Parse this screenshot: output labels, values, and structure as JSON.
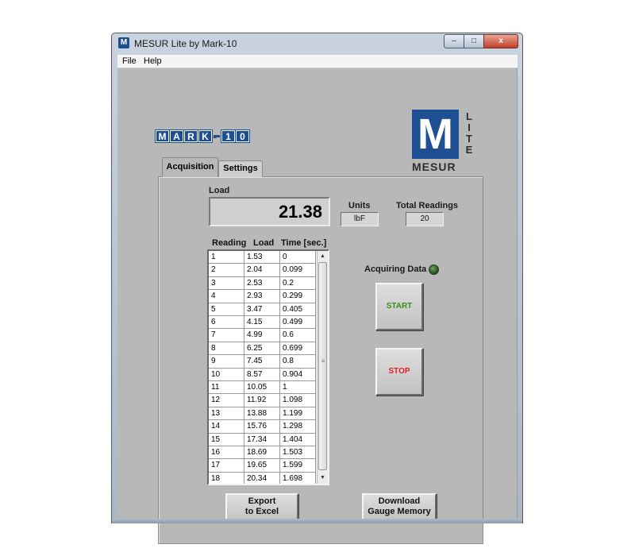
{
  "window": {
    "title": "MESUR Lite by Mark-10",
    "min_glyph": "–",
    "max_glyph": "□",
    "close_glyph": "x"
  },
  "menu": {
    "file": "File",
    "help": "Help"
  },
  "branding": {
    "mark10_letters": [
      "M",
      "A",
      "R",
      "K",
      "-",
      "1",
      "0"
    ],
    "mesur_m": "M",
    "mesur_word": "MESUR",
    "lite_letters": [
      "L",
      "I",
      "T",
      "E"
    ],
    "brand_color": "#1f4f93"
  },
  "tabs": {
    "acquisition": "Acquisition",
    "settings": "Settings",
    "active": "Acquisition"
  },
  "load": {
    "label": "Load",
    "value": "21.38"
  },
  "units": {
    "label": "Units",
    "value": "lbF"
  },
  "total_readings": {
    "label": "Total Readings",
    "value": "20"
  },
  "table": {
    "headers": [
      "Reading",
      "Load",
      "Time [sec.]"
    ],
    "rows": [
      [
        "1",
        "1.53",
        "0"
      ],
      [
        "2",
        "2.04",
        "0.099"
      ],
      [
        "3",
        "2.53",
        "0.2"
      ],
      [
        "4",
        "2.93",
        "0.299"
      ],
      [
        "5",
        "3.47",
        "0.405"
      ],
      [
        "6",
        "4.15",
        "0.499"
      ],
      [
        "7",
        "4.99",
        "0.6"
      ],
      [
        "8",
        "6.25",
        "0.699"
      ],
      [
        "9",
        "7.45",
        "0.8"
      ],
      [
        "10",
        "8.57",
        "0.904"
      ],
      [
        "11",
        "10.05",
        "1"
      ],
      [
        "12",
        "11.92",
        "1.098"
      ],
      [
        "13",
        "13.88",
        "1.199"
      ],
      [
        "14",
        "15.76",
        "1.298"
      ],
      [
        "15",
        "17.34",
        "1.404"
      ],
      [
        "16",
        "18.69",
        "1.503"
      ],
      [
        "17",
        "19.65",
        "1.599"
      ],
      [
        "18",
        "20.34",
        "1.698"
      ]
    ],
    "scroll_up_glyph": "▲",
    "scroll_down_glyph": "▼",
    "scroll_grip_glyph": "≡"
  },
  "status": {
    "acquiring_label": "Acquiring Data",
    "led_color": "#2f6a26"
  },
  "buttons": {
    "start": "START",
    "stop": "STOP",
    "start_color": "#3d8a1e",
    "stop_color": "#e02020",
    "export_line1": "Export",
    "export_line2": "to Excel",
    "download_line1": "Download",
    "download_line2": "Gauge Memory"
  }
}
